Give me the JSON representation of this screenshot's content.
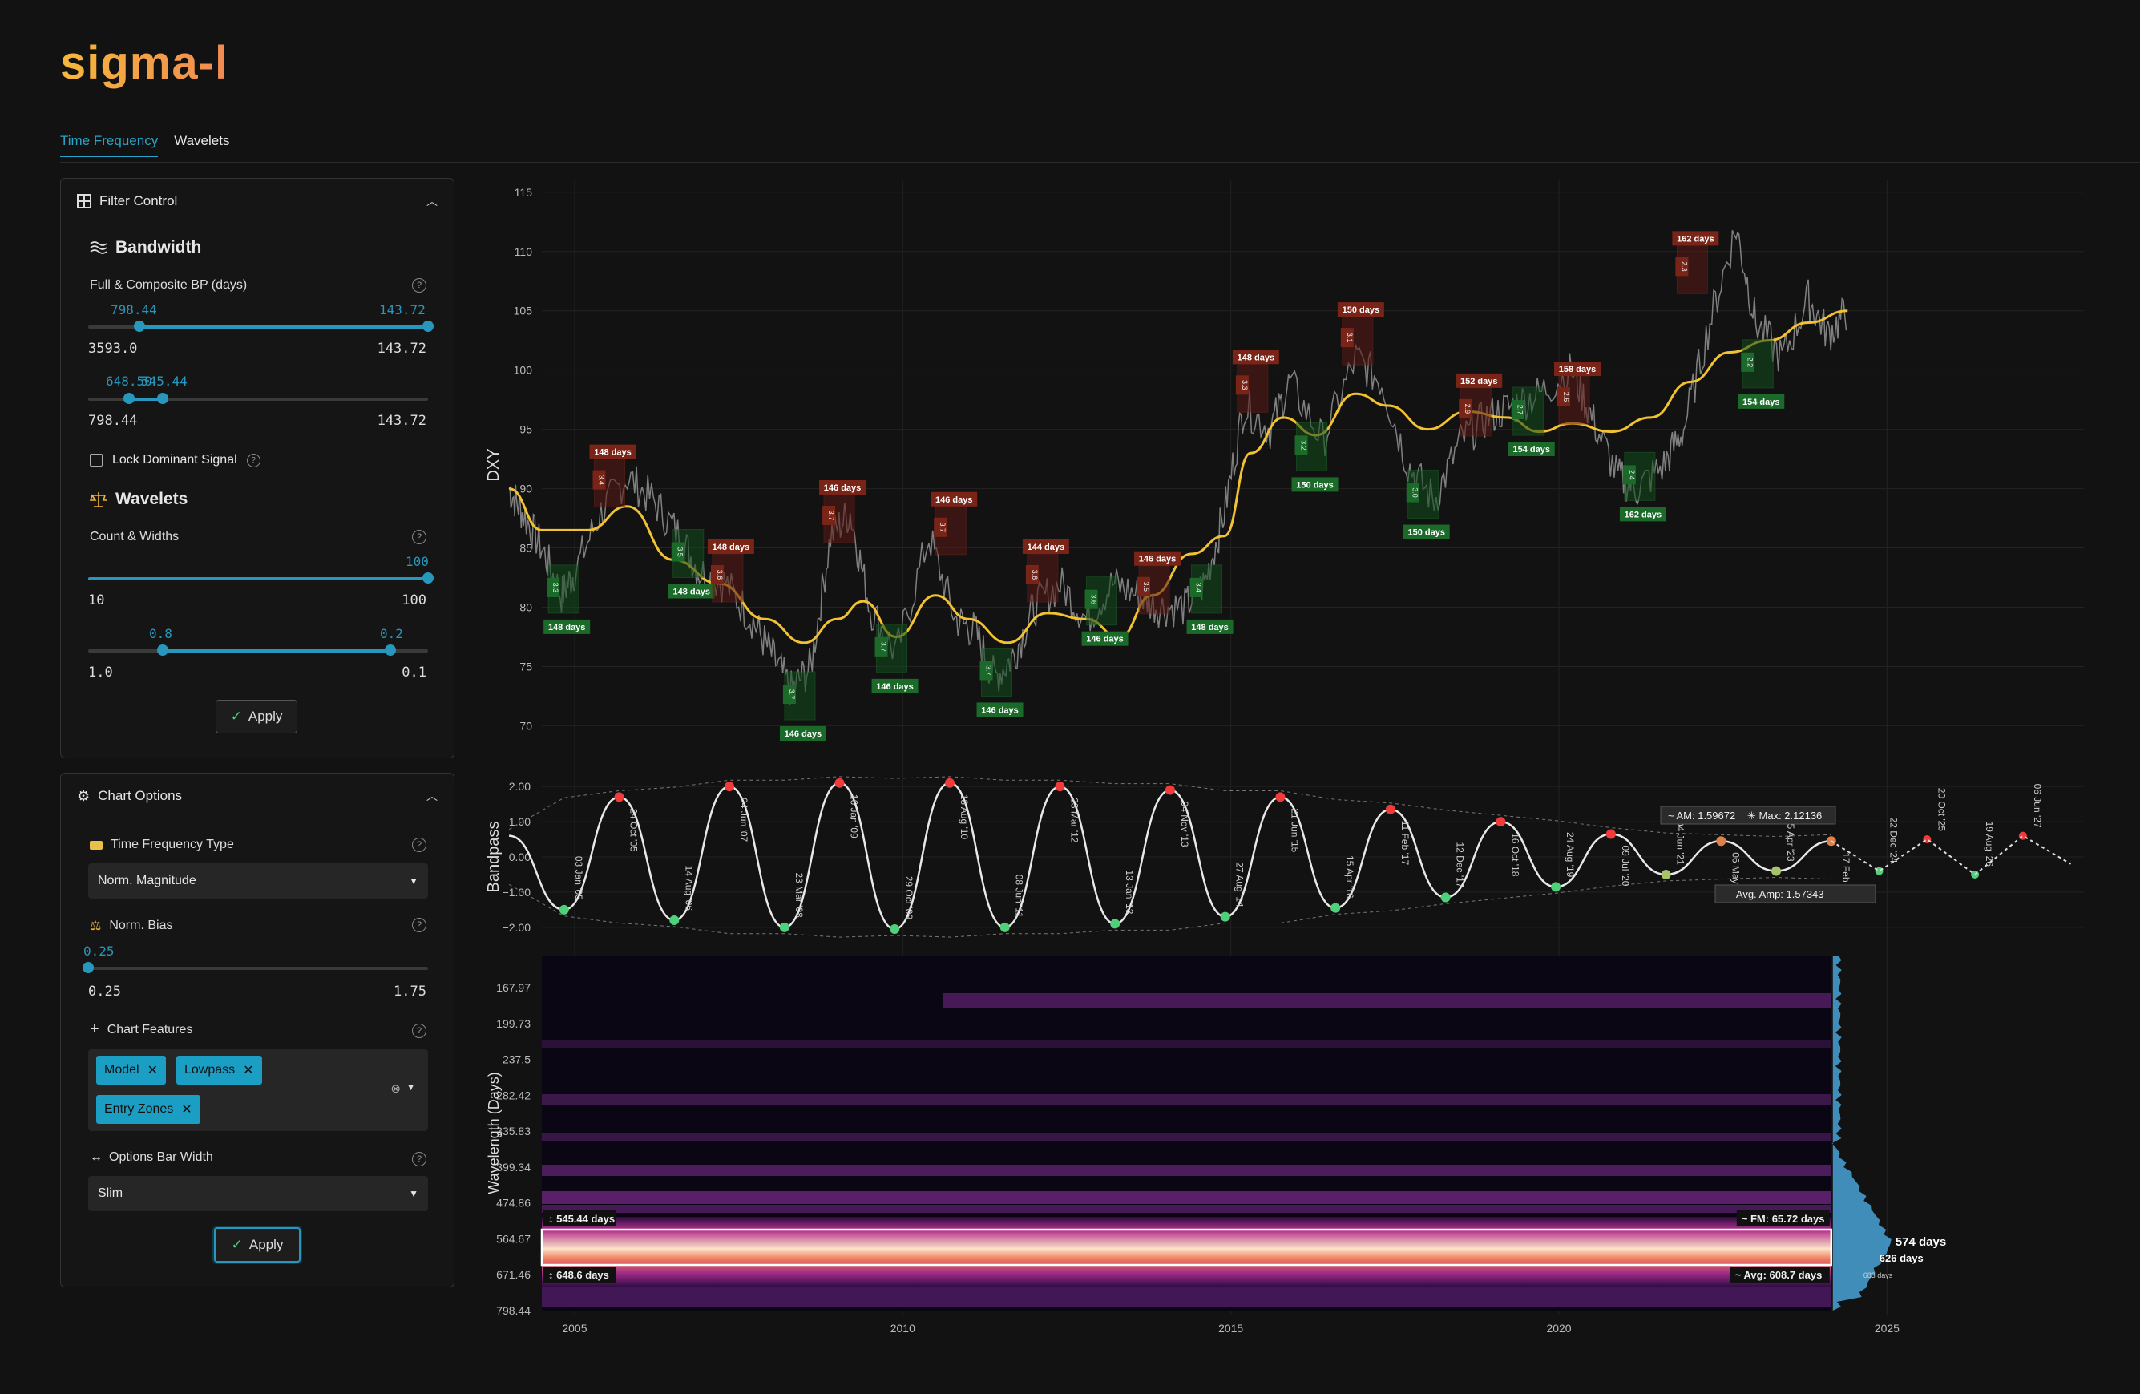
{
  "app": {
    "logo": "sigma-l"
  },
  "tabs": [
    {
      "label": "Time Frequency",
      "active": true
    },
    {
      "label": "Wavelets",
      "active": false
    }
  ],
  "filter_control": {
    "title": "Filter Control",
    "bandwidth": {
      "title": "Bandwidth",
      "label": "Full & Composite BP (days)",
      "slider1": {
        "low": "798.44",
        "high": "143.72",
        "min": "3593.0",
        "max": "143.72",
        "low_frac": 0.15,
        "high_frac": 1.0
      },
      "slider2": {
        "low": "648.50",
        "high": "545.44",
        "min": "798.44",
        "max": "143.72",
        "low_frac": 0.12,
        "high_frac": 0.22
      }
    },
    "lock": {
      "label": "Lock Dominant Signal",
      "checked": false
    },
    "wavelets": {
      "title": "Wavelets",
      "label": "Count & Widths",
      "slider1": {
        "high": "100",
        "min": "10",
        "max": "100",
        "high_frac": 1.0
      },
      "slider2": {
        "low": "0.8",
        "high": "0.2",
        "min": "1.0",
        "max": "0.1",
        "low_frac": 0.22,
        "high_frac": 0.89
      }
    },
    "apply": "Apply"
  },
  "chart_options": {
    "title": "Chart Options",
    "tf_type": {
      "label": "Time Frequency Type",
      "value": "Norm. Magnitude"
    },
    "norm_bias": {
      "label": "Norm. Bias",
      "value": "0.25",
      "min": "0.25",
      "max": "1.75",
      "frac": 0.0
    },
    "features": {
      "label": "Chart Features",
      "chips": [
        "Model",
        "Lowpass",
        "Entry Zones"
      ]
    },
    "bar_width": {
      "label": "Options Bar Width",
      "value": "Slim"
    },
    "apply": "Apply"
  },
  "chart_data": [
    {
      "type": "line",
      "ylabel": "DXY",
      "ylim": [
        68,
        116
      ],
      "xlim": [
        2004.5,
        2028
      ],
      "xticks": [
        2005,
        2010,
        2015,
        2020,
        2025
      ],
      "yticks": [
        70,
        75,
        80,
        85,
        90,
        95,
        100,
        105,
        110,
        115
      ],
      "price": [
        [
          2004.0,
          90
        ],
        [
          2004.2,
          88
        ],
        [
          2004.5,
          85
        ],
        [
          2004.8,
          81
        ],
        [
          2005.0,
          83
        ],
        [
          2005.4,
          88
        ],
        [
          2005.8,
          91
        ],
        [
          2006.2,
          89
        ],
        [
          2006.6,
          86
        ],
        [
          2006.9,
          83
        ],
        [
          2007.3,
          82
        ],
        [
          2007.7,
          79
        ],
        [
          2008.0,
          76
        ],
        [
          2008.3,
          73
        ],
        [
          2008.6,
          75
        ],
        [
          2008.9,
          86
        ],
        [
          2009.2,
          88
        ],
        [
          2009.5,
          80
        ],
        [
          2009.9,
          76
        ],
        [
          2010.4,
          86
        ],
        [
          2010.8,
          79
        ],
        [
          2011.1,
          78
        ],
        [
          2011.4,
          74
        ],
        [
          2011.7,
          76
        ],
        [
          2012.0,
          80
        ],
        [
          2012.4,
          82
        ],
        [
          2012.8,
          79
        ],
        [
          2013.2,
          82
        ],
        [
          2013.6,
          81
        ],
        [
          2013.9,
          80
        ],
        [
          2014.3,
          80
        ],
        [
          2014.6,
          82
        ],
        [
          2014.9,
          88
        ],
        [
          2015.2,
          97
        ],
        [
          2015.6,
          95
        ],
        [
          2015.9,
          99
        ],
        [
          2016.4,
          94
        ],
        [
          2016.9,
          101
        ],
        [
          2017.3,
          99
        ],
        [
          2017.7,
          92
        ],
        [
          2018.1,
          89
        ],
        [
          2018.5,
          94
        ],
        [
          2018.9,
          96
        ],
        [
          2019.3,
          97
        ],
        [
          2019.7,
          98
        ],
        [
          2020.2,
          100
        ],
        [
          2020.5,
          96
        ],
        [
          2020.9,
          91
        ],
        [
          2021.2,
          90
        ],
        [
          2021.6,
          92
        ],
        [
          2021.9,
          95
        ],
        [
          2022.3,
          104
        ],
        [
          2022.7,
          112
        ],
        [
          2023.0,
          104
        ],
        [
          2023.4,
          101
        ],
        [
          2023.8,
          106
        ],
        [
          2024.1,
          103
        ],
        [
          2024.4,
          105
        ]
      ],
      "lowpass": [
        [
          2004.0,
          90
        ],
        [
          2004.5,
          86.5
        ],
        [
          2005.2,
          86.5
        ],
        [
          2005.8,
          88.5
        ],
        [
          2006.5,
          84
        ],
        [
          2007.2,
          82
        ],
        [
          2007.9,
          79
        ],
        [
          2008.5,
          77
        ],
        [
          2009.0,
          79
        ],
        [
          2009.4,
          80.5
        ],
        [
          2009.9,
          77.5
        ],
        [
          2010.5,
          81
        ],
        [
          2011.0,
          79
        ],
        [
          2011.6,
          77
        ],
        [
          2012.2,
          79.5
        ],
        [
          2012.8,
          79
        ],
        [
          2013.3,
          77.5
        ],
        [
          2013.8,
          81
        ],
        [
          2014.4,
          84.5
        ],
        [
          2014.9,
          86
        ],
        [
          2015.3,
          93
        ],
        [
          2015.8,
          96
        ],
        [
          2016.3,
          94.5
        ],
        [
          2016.9,
          98
        ],
        [
          2017.4,
          97
        ],
        [
          2018.0,
          95
        ],
        [
          2018.6,
          96.5
        ],
        [
          2019.2,
          96
        ],
        [
          2019.7,
          94.8
        ],
        [
          2020.2,
          95.5
        ],
        [
          2020.8,
          94.8
        ],
        [
          2021.4,
          96
        ],
        [
          2022.0,
          99
        ],
        [
          2022.6,
          101.5
        ],
        [
          2023.2,
          102.5
        ],
        [
          2023.8,
          104
        ],
        [
          2024.4,
          105
        ]
      ],
      "entry_zones": [
        {
          "kind": "high",
          "x": 2005.3,
          "y": 92.5,
          "label": "148 days",
          "sub": "3.4"
        },
        {
          "kind": "low",
          "x": 2004.6,
          "y": 79.5,
          "label": "148 days",
          "sub": "3.3"
        },
        {
          "kind": "low",
          "x": 2006.5,
          "y": 82.5,
          "label": "148 days",
          "sub": "3.5"
        },
        {
          "kind": "high",
          "x": 2007.1,
          "y": 84.5,
          "label": "148 days",
          "sub": "3.6"
        },
        {
          "kind": "low",
          "x": 2008.2,
          "y": 70.5,
          "label": "146 days",
          "sub": "3.7"
        },
        {
          "kind": "high",
          "x": 2008.8,
          "y": 89.5,
          "label": "146 days",
          "sub": "3.7"
        },
        {
          "kind": "low",
          "x": 2009.6,
          "y": 74.5,
          "label": "146 days",
          "sub": "3.7"
        },
        {
          "kind": "high",
          "x": 2010.5,
          "y": 88.5,
          "label": "146 days",
          "sub": "3.7"
        },
        {
          "kind": "low",
          "x": 2011.2,
          "y": 72.5,
          "label": "146 days",
          "sub": "3.7"
        },
        {
          "kind": "high",
          "x": 2011.9,
          "y": 84.5,
          "label": "144 days",
          "sub": "3.6"
        },
        {
          "kind": "low",
          "x": 2012.8,
          "y": 78.5,
          "label": "146 days",
          "sub": "3.6"
        },
        {
          "kind": "high",
          "x": 2013.6,
          "y": 83.5,
          "label": "146 days",
          "sub": "3.5"
        },
        {
          "kind": "low",
          "x": 2014.4,
          "y": 79.5,
          "label": "148 days",
          "sub": "3.4"
        },
        {
          "kind": "high",
          "x": 2015.1,
          "y": 100.5,
          "label": "148 days",
          "sub": "3.3"
        },
        {
          "kind": "low",
          "x": 2016.0,
          "y": 91.5,
          "label": "150 days",
          "sub": "3.2"
        },
        {
          "kind": "high",
          "x": 2016.7,
          "y": 104.5,
          "label": "150 days",
          "sub": "3.1"
        },
        {
          "kind": "low",
          "x": 2017.7,
          "y": 87.5,
          "label": "150 days",
          "sub": "3.0"
        },
        {
          "kind": "high",
          "x": 2018.5,
          "y": 98.5,
          "label": "152 days",
          "sub": "2.9"
        },
        {
          "kind": "low",
          "x": 2019.3,
          "y": 94.5,
          "label": "154 days",
          "sub": "2.7"
        },
        {
          "kind": "high",
          "x": 2020.0,
          "y": 99.5,
          "label": "158 days",
          "sub": "2.6"
        },
        {
          "kind": "low",
          "x": 2021.0,
          "y": 89.0,
          "label": "162 days",
          "sub": "2.4"
        },
        {
          "kind": "high",
          "x": 2021.8,
          "y": 110.5,
          "label": "162 days",
          "sub": "2.3"
        },
        {
          "kind": "low",
          "x": 2022.8,
          "y": 98.5,
          "label": "154 days",
          "sub": "2.2"
        }
      ]
    },
    {
      "type": "line",
      "ylabel": "Bandpass",
      "ylim": [
        -2.3,
        2.3
      ],
      "yticks": [
        "2.00",
        "1.00",
        "0.00",
        "−1.00",
        "−2.00"
      ],
      "peaks": [
        [
          "24 Oct '05",
          1.7
        ],
        [
          "04 Jun '07",
          2.0
        ],
        [
          "16 Jan '09",
          2.1
        ],
        [
          "18 Aug '10",
          2.1
        ],
        [
          "23 Mar '12",
          2.0
        ],
        [
          "04 Nov '13",
          1.9
        ],
        [
          "21 Jun '15",
          1.7
        ],
        [
          "11 Feb '17",
          1.35
        ],
        [
          "16 Oct '18",
          1.0
        ],
        [
          "09 Jul '20",
          0.65
        ],
        [
          "06 May '22",
          0.45
        ],
        [
          "17 Feb '24",
          0.45
        ]
      ],
      "troughs": [
        [
          "03 Jan '05",
          -1.5
        ],
        [
          "14 Aug '06",
          -1.8
        ],
        [
          "23 Mar '08",
          -2.0
        ],
        [
          "29 Oct '09",
          -2.05
        ],
        [
          "08 Jun '11",
          -2.0
        ],
        [
          "13 Jan '13",
          -1.9
        ],
        [
          "27 Aug '14",
          -1.7
        ],
        [
          "15 Apr '16",
          -1.45
        ],
        [
          "12 Dec '17",
          -1.15
        ],
        [
          "24 Aug '19",
          -0.85
        ],
        [
          "04 Jun '21",
          -0.5
        ],
        [
          "05 Apr '23",
          -0.4
        ]
      ],
      "projection_peaks": [
        [
          "20 Oct '25",
          0.5
        ],
        [
          "06 Jun '27",
          0.6
        ]
      ],
      "projection_troughs": [
        [
          "22 Dec '24",
          -0.4
        ],
        [
          "19 Aug '26",
          -0.5
        ]
      ],
      "annotations": {
        "am": "AM: 1.59672",
        "max": "Max: 2.12136",
        "avg_amp": "Avg. Amp: 1.57343"
      }
    },
    {
      "type": "heatmap",
      "ylabel": "Wavelength (Days)",
      "yticks": [
        "167.97",
        "199.73",
        "237.5",
        "282.42",
        "335.83",
        "399.34",
        "474.86",
        "564.67",
        "671.46",
        "798.44"
      ],
      "band": {
        "upper": "545.44 days",
        "lower": "648.6 days",
        "fm": "FM: 65.72 days",
        "avg": "Avg: 608.7 days"
      },
      "histogram_labels": [
        {
          "value": "574",
          "unit": "days"
        },
        {
          "value": "626",
          "unit": "days"
        },
        {
          "value": "683",
          "unit": "days"
        }
      ]
    }
  ]
}
